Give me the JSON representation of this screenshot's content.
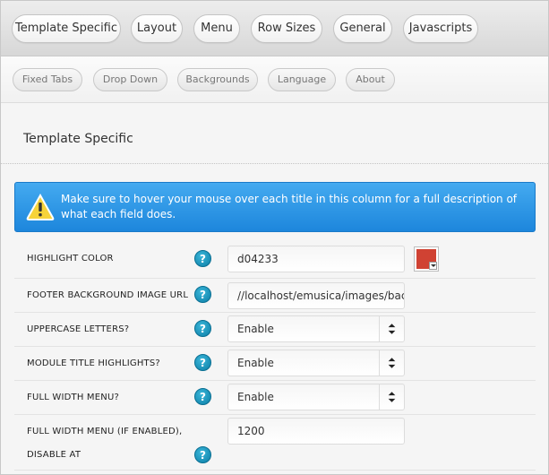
{
  "primary_tabs": [
    {
      "label": "Template Specific"
    },
    {
      "label": "Layout"
    },
    {
      "label": "Menu"
    },
    {
      "label": "Row Sizes"
    },
    {
      "label": "General"
    },
    {
      "label": "Javascripts"
    }
  ],
  "secondary_tabs": [
    {
      "label": "Fixed Tabs"
    },
    {
      "label": "Drop Down"
    },
    {
      "label": "Backgrounds"
    },
    {
      "label": "Language"
    },
    {
      "label": "About"
    }
  ],
  "section": {
    "title": "Template Specific"
  },
  "alert": {
    "text": "Make sure to hover your mouse over each title in this column for a full description of what each field does.",
    "icon": "warning-icon"
  },
  "fields": [
    {
      "label": "HIGHLIGHT COLOR",
      "type": "color",
      "value": "d04233",
      "swatch_color": "#d04233"
    },
    {
      "label": "FOOTER BACKGROUND IMAGE URL",
      "type": "text",
      "value": "//localhost/emusica/images/backgr"
    },
    {
      "label": "UPPERCASE LETTERS?",
      "type": "select",
      "value": "Enable"
    },
    {
      "label": "MODULE TITLE HIGHLIGHTS?",
      "type": "select",
      "value": "Enable"
    },
    {
      "label": "FULL WIDTH MENU?",
      "type": "select",
      "value": "Enable"
    },
    {
      "label": "FULL WIDTH MENU (IF ENABLED), DISABLE AT",
      "type": "text",
      "value": "1200"
    }
  ],
  "help_icon": {
    "glyph": "?"
  },
  "colors": {
    "alert_blue": "#1d86dc",
    "help_blue": "#0b7ea6",
    "highlight": "#d04233"
  }
}
